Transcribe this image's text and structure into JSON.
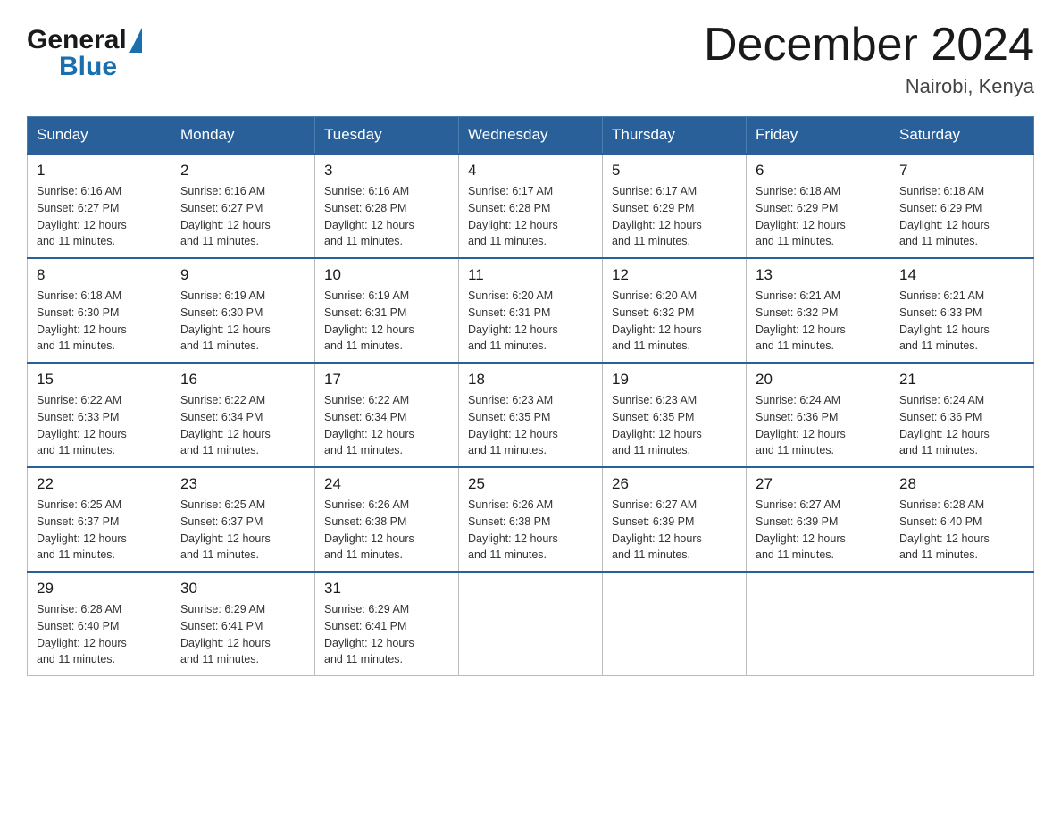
{
  "header": {
    "logo_general": "General",
    "logo_blue": "Blue",
    "month_title": "December 2024",
    "location": "Nairobi, Kenya"
  },
  "days_of_week": [
    "Sunday",
    "Monday",
    "Tuesday",
    "Wednesday",
    "Thursday",
    "Friday",
    "Saturday"
  ],
  "weeks": [
    [
      {
        "day": "1",
        "sunrise": "6:16 AM",
        "sunset": "6:27 PM",
        "daylight": "12 hours and 11 minutes."
      },
      {
        "day": "2",
        "sunrise": "6:16 AM",
        "sunset": "6:27 PM",
        "daylight": "12 hours and 11 minutes."
      },
      {
        "day": "3",
        "sunrise": "6:16 AM",
        "sunset": "6:28 PM",
        "daylight": "12 hours and 11 minutes."
      },
      {
        "day": "4",
        "sunrise": "6:17 AM",
        "sunset": "6:28 PM",
        "daylight": "12 hours and 11 minutes."
      },
      {
        "day": "5",
        "sunrise": "6:17 AM",
        "sunset": "6:29 PM",
        "daylight": "12 hours and 11 minutes."
      },
      {
        "day": "6",
        "sunrise": "6:18 AM",
        "sunset": "6:29 PM",
        "daylight": "12 hours and 11 minutes."
      },
      {
        "day": "7",
        "sunrise": "6:18 AM",
        "sunset": "6:29 PM",
        "daylight": "12 hours and 11 minutes."
      }
    ],
    [
      {
        "day": "8",
        "sunrise": "6:18 AM",
        "sunset": "6:30 PM",
        "daylight": "12 hours and 11 minutes."
      },
      {
        "day": "9",
        "sunrise": "6:19 AM",
        "sunset": "6:30 PM",
        "daylight": "12 hours and 11 minutes."
      },
      {
        "day": "10",
        "sunrise": "6:19 AM",
        "sunset": "6:31 PM",
        "daylight": "12 hours and 11 minutes."
      },
      {
        "day": "11",
        "sunrise": "6:20 AM",
        "sunset": "6:31 PM",
        "daylight": "12 hours and 11 minutes."
      },
      {
        "day": "12",
        "sunrise": "6:20 AM",
        "sunset": "6:32 PM",
        "daylight": "12 hours and 11 minutes."
      },
      {
        "day": "13",
        "sunrise": "6:21 AM",
        "sunset": "6:32 PM",
        "daylight": "12 hours and 11 minutes."
      },
      {
        "day": "14",
        "sunrise": "6:21 AM",
        "sunset": "6:33 PM",
        "daylight": "12 hours and 11 minutes."
      }
    ],
    [
      {
        "day": "15",
        "sunrise": "6:22 AM",
        "sunset": "6:33 PM",
        "daylight": "12 hours and 11 minutes."
      },
      {
        "day": "16",
        "sunrise": "6:22 AM",
        "sunset": "6:34 PM",
        "daylight": "12 hours and 11 minutes."
      },
      {
        "day": "17",
        "sunrise": "6:22 AM",
        "sunset": "6:34 PM",
        "daylight": "12 hours and 11 minutes."
      },
      {
        "day": "18",
        "sunrise": "6:23 AM",
        "sunset": "6:35 PM",
        "daylight": "12 hours and 11 minutes."
      },
      {
        "day": "19",
        "sunrise": "6:23 AM",
        "sunset": "6:35 PM",
        "daylight": "12 hours and 11 minutes."
      },
      {
        "day": "20",
        "sunrise": "6:24 AM",
        "sunset": "6:36 PM",
        "daylight": "12 hours and 11 minutes."
      },
      {
        "day": "21",
        "sunrise": "6:24 AM",
        "sunset": "6:36 PM",
        "daylight": "12 hours and 11 minutes."
      }
    ],
    [
      {
        "day": "22",
        "sunrise": "6:25 AM",
        "sunset": "6:37 PM",
        "daylight": "12 hours and 11 minutes."
      },
      {
        "day": "23",
        "sunrise": "6:25 AM",
        "sunset": "6:37 PM",
        "daylight": "12 hours and 11 minutes."
      },
      {
        "day": "24",
        "sunrise": "6:26 AM",
        "sunset": "6:38 PM",
        "daylight": "12 hours and 11 minutes."
      },
      {
        "day": "25",
        "sunrise": "6:26 AM",
        "sunset": "6:38 PM",
        "daylight": "12 hours and 11 minutes."
      },
      {
        "day": "26",
        "sunrise": "6:27 AM",
        "sunset": "6:39 PM",
        "daylight": "12 hours and 11 minutes."
      },
      {
        "day": "27",
        "sunrise": "6:27 AM",
        "sunset": "6:39 PM",
        "daylight": "12 hours and 11 minutes."
      },
      {
        "day": "28",
        "sunrise": "6:28 AM",
        "sunset": "6:40 PM",
        "daylight": "12 hours and 11 minutes."
      }
    ],
    [
      {
        "day": "29",
        "sunrise": "6:28 AM",
        "sunset": "6:40 PM",
        "daylight": "12 hours and 11 minutes."
      },
      {
        "day": "30",
        "sunrise": "6:29 AM",
        "sunset": "6:41 PM",
        "daylight": "12 hours and 11 minutes."
      },
      {
        "day": "31",
        "sunrise": "6:29 AM",
        "sunset": "6:41 PM",
        "daylight": "12 hours and 11 minutes."
      },
      null,
      null,
      null,
      null
    ]
  ],
  "labels": {
    "sunrise": "Sunrise:",
    "sunset": "Sunset:",
    "daylight": "Daylight:"
  }
}
